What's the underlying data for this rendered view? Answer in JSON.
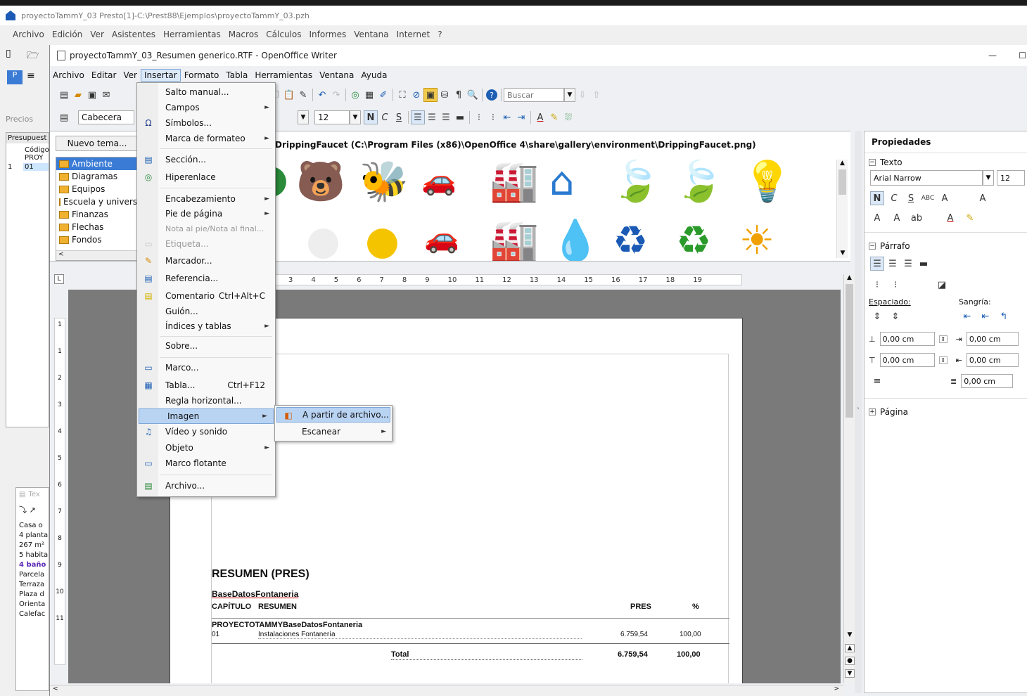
{
  "presto": {
    "title": "proyectoTammY_03 Presto[1]-C:\\Prest88\\Ejemplos\\proyectoTammY_03.pzh",
    "menu": [
      "Archivo",
      "Edición",
      "Ver",
      "Asistentes",
      "Herramientas",
      "Macros",
      "Cálculos",
      "Informes",
      "Ventana",
      "Internet",
      "?"
    ],
    "left_labels": {
      "precios": "Precios",
      "presupuesto": "Presupuest",
      "codigo": "Código",
      "proy": "PROY",
      "row_num": "1",
      "row_code": "01",
      "tex": "Tex"
    },
    "left_text": [
      "Casa o",
      "4 planta",
      "267 m²",
      "5 habita",
      "4 baño",
      "Parcela",
      "Terraza",
      "Plaza d",
      "Orienta",
      "Calefac"
    ]
  },
  "writer": {
    "title": "proyectoTammY_03_Resumen generico.RTF - OpenOffice Writer",
    "menu": [
      "Archivo",
      "Editar",
      "Ver",
      "Insertar",
      "Formato",
      "Tabla",
      "Herramientas",
      "Ventana",
      "Ayuda"
    ],
    "search_placeholder": "Buscar",
    "style": "Cabecera",
    "font_size": "12",
    "bold": "N",
    "italic": "C",
    "underline": "S",
    "minimize": "—",
    "maximize": "☐"
  },
  "gallery": {
    "new_theme": "Nuevo tema...",
    "path": "DrippingFaucet (C:\\Program Files (x86)\\OpenOffice 4\\share\\gallery\\environment\\DrippingFaucet.png)",
    "categories": [
      "Ambiente",
      "Diagramas",
      "Equipos",
      "Escuela y universidad",
      "Finanzas",
      "Flechas",
      "Fondos"
    ],
    "selected": "Ambiente"
  },
  "ruler": {
    "ticks": [
      "3",
      "4",
      "5",
      "6",
      "7",
      "8",
      "9",
      "10",
      "11",
      "12",
      "13",
      "14",
      "15",
      "16",
      "17",
      "18",
      "19"
    ],
    "vticks": [
      "1",
      "1",
      "2",
      "3",
      "4",
      "5",
      "6",
      "7",
      "8",
      "9",
      "10",
      "11"
    ]
  },
  "insert_menu": [
    {
      "label": "Salto manual...",
      "sub": false
    },
    {
      "label": "Campos",
      "sub": true
    },
    {
      "label": "Símbolos...",
      "sub": false,
      "icon": "symbols-icon"
    },
    {
      "label": "Marca de formateo",
      "sub": true
    },
    {
      "label": "Sección...",
      "sub": false,
      "icon": "section-icon"
    },
    {
      "label": "Hiperenlace",
      "sub": false,
      "icon": "hyperlink-icon"
    },
    {
      "label": "Encabezamiento",
      "sub": true
    },
    {
      "label": "Pie de página",
      "sub": true
    },
    {
      "label": "Nota al pie/Nota al final...",
      "sub": false,
      "disabled": true
    },
    {
      "label": "Etiqueta...",
      "sub": false,
      "disabled": true
    },
    {
      "label": "Marcador...",
      "sub": false,
      "icon": "bookmark-icon"
    },
    {
      "label": "Referencia...",
      "sub": false,
      "icon": "reference-icon"
    },
    {
      "label": "Comentario",
      "shortcut": "Ctrl+Alt+C",
      "icon": "comment-icon"
    },
    {
      "label": "Guión...",
      "sub": false
    },
    {
      "label": "Índices y tablas",
      "sub": true
    },
    {
      "label": "Sobre...",
      "sub": false
    },
    {
      "label": "Marco...",
      "sub": false,
      "icon": "frame-icon"
    },
    {
      "label": "Tabla...",
      "shortcut": "Ctrl+F12",
      "icon": "table-icon"
    },
    {
      "label": "Regla horizontal...",
      "sub": false
    },
    {
      "label": "Imagen",
      "sub": true,
      "highlighted": true
    },
    {
      "label": "Vídeo y sonido",
      "sub": false,
      "icon": "media-icon"
    },
    {
      "label": "Objeto",
      "sub": true
    },
    {
      "label": "Marco flotante",
      "sub": false,
      "icon": "floating-frame-icon"
    },
    {
      "label": "Archivo...",
      "sub": false,
      "icon": "file-icon"
    }
  ],
  "image_submenu": [
    {
      "label": "A partir de archivo...",
      "highlighted": true
    },
    {
      "label": "Escanear",
      "sub": true
    }
  ],
  "document": {
    "heading": "RESUMEN (PRES)",
    "subheading": "BaseDatosFontaneria",
    "col_capitulo": "CAPÍTULO",
    "col_resumen": "RESUMEN",
    "col_pres": "PRES",
    "col_pct": "%",
    "group": "PROYECTOTAMMYBaseDatosFontaneria",
    "row_code": "01",
    "row_desc": "Instalaciones Fontanería",
    "row_pres": "6.759,54",
    "row_pct": "100,00",
    "total_label": "Total",
    "total_pres": "6.759,54",
    "total_pct": "100,00"
  },
  "properties": {
    "title": "Propiedades",
    "texto": "Texto",
    "font": "Arial Narrow",
    "size": "12",
    "parrafo": "Párrafo",
    "espaciado": "Espaciado:",
    "sangria": "Sangría:",
    "v1": "0,00 cm",
    "v2": "0,00 cm",
    "v3": "0,00 cm",
    "v4": "0,00 cm",
    "v5": "0,00 cm",
    "pagina": "Página"
  }
}
